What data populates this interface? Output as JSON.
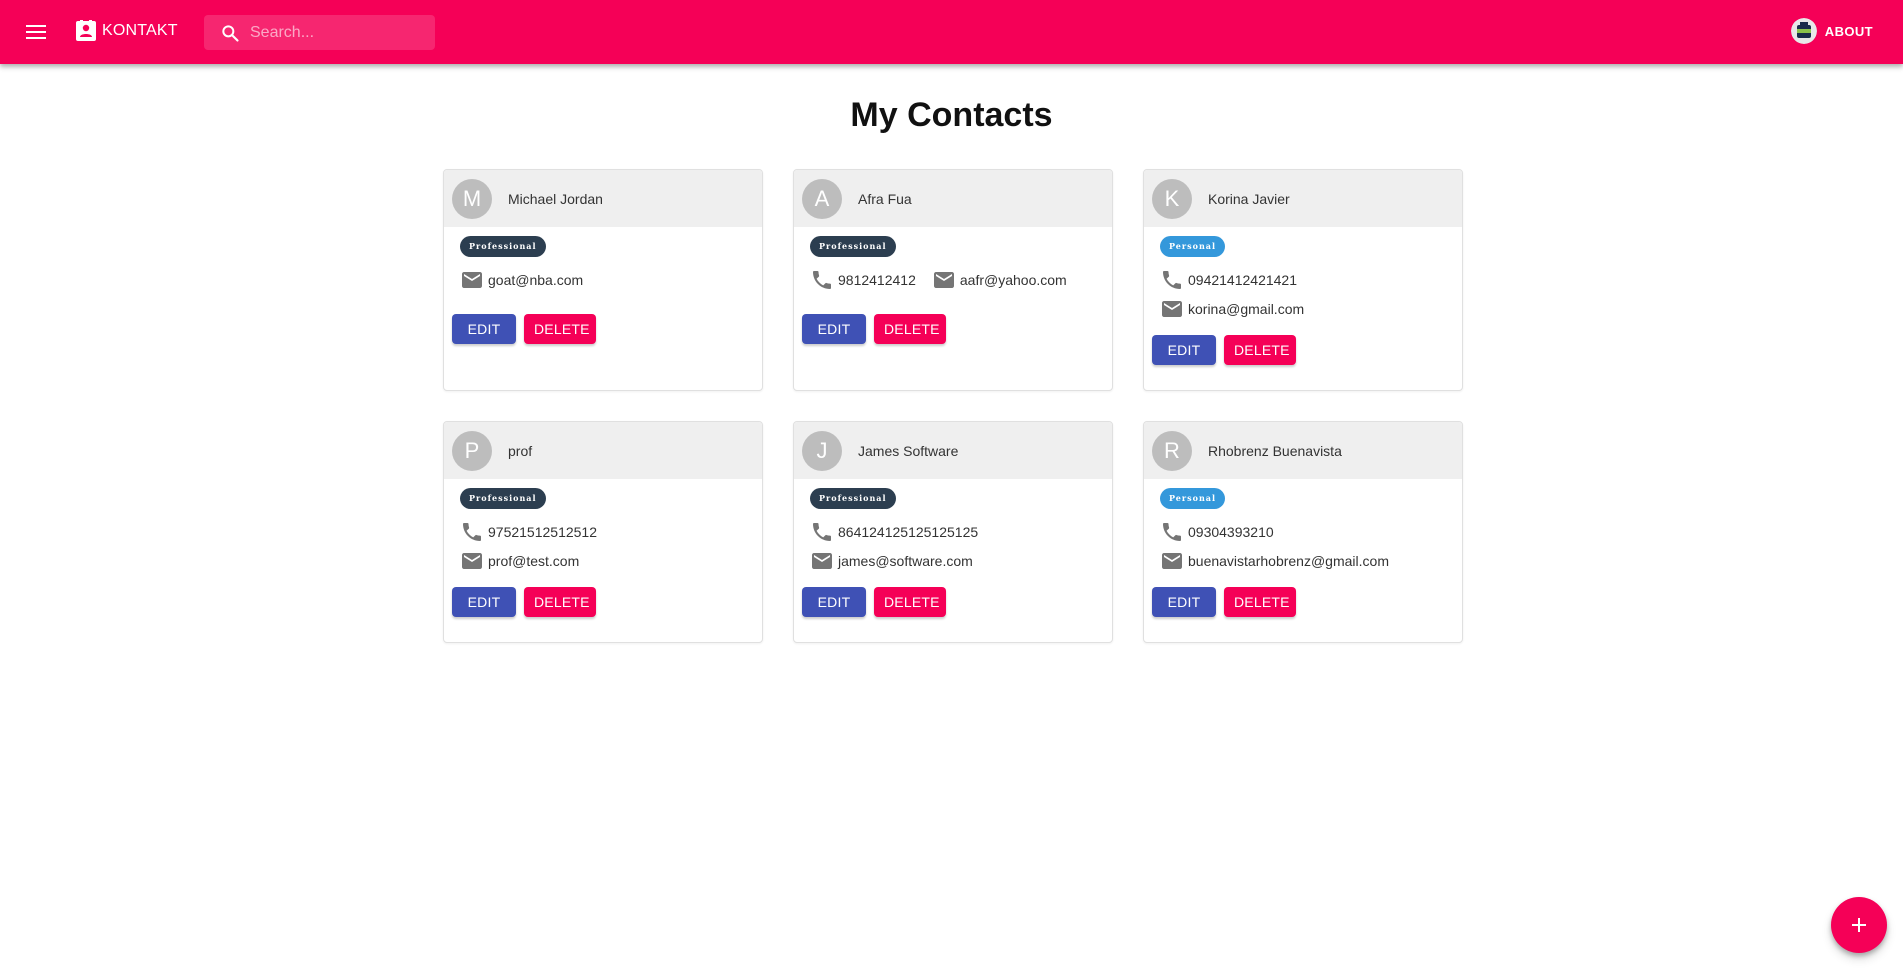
{
  "app": {
    "brand_label": "KONTAKT",
    "about_label": "ABOUT",
    "search_placeholder": "Search...",
    "accent_color": "#f50057",
    "edit_color": "#3f51b5"
  },
  "page": {
    "title": "My Contacts"
  },
  "contacts": [
    {
      "initial": "M",
      "name": "Michael Jordan",
      "tag": "Professional",
      "phone": "",
      "email": "goat@nba.com",
      "layout": "inline"
    },
    {
      "initial": "A",
      "name": "Afra Fua",
      "tag": "Professional",
      "phone": "9812412412",
      "email": "aafr@yahoo.com",
      "layout": "inline"
    },
    {
      "initial": "K",
      "name": "Korina Javier",
      "tag": "Personal",
      "phone": "09421412421421",
      "email": "korina@gmail.com",
      "layout": "stack"
    },
    {
      "initial": "P",
      "name": "prof",
      "tag": "Professional",
      "phone": "97521512512512",
      "email": "prof@test.com",
      "layout": "stack"
    },
    {
      "initial": "J",
      "name": "James Software",
      "tag": "Professional",
      "phone": "864124125125125125",
      "email": "james@software.com",
      "layout": "stack"
    },
    {
      "initial": "R",
      "name": "Rhobrenz Buenavista",
      "tag": "Personal",
      "phone": "09304393210",
      "email": "buenavistarhobrenz@gmail.com",
      "layout": "stack"
    }
  ],
  "buttons": {
    "edit_label": "EDIT",
    "delete_label": "DELETE"
  },
  "tag_colors": {
    "Professional": "#2c3e50",
    "Personal": "#3498db"
  },
  "icons": {
    "menu": "menu-icon",
    "brand": "contacts-icon",
    "search": "search-icon",
    "phone": "phone-icon",
    "email": "email-icon",
    "fab": "add-icon"
  }
}
